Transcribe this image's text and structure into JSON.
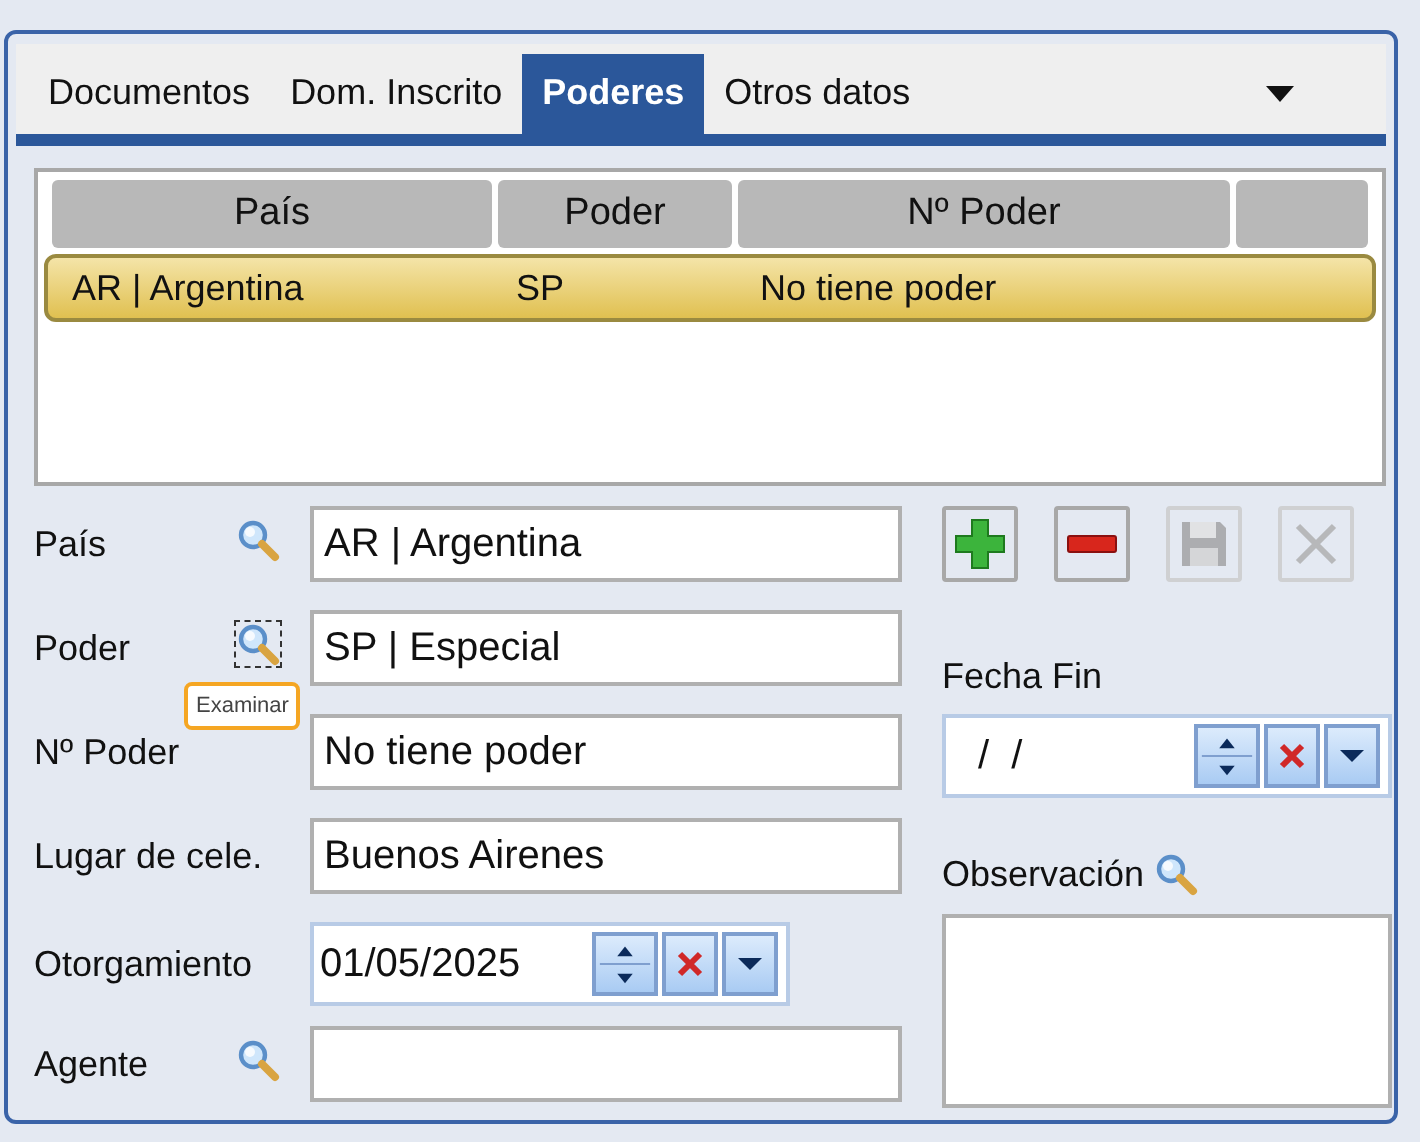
{
  "tabs": [
    {
      "label": "Documentos",
      "selected": false
    },
    {
      "label": "Dom. Inscrito",
      "selected": false
    },
    {
      "label": "Poderes",
      "selected": true
    },
    {
      "label": "Otros datos",
      "selected": false
    }
  ],
  "grid": {
    "columns": [
      "País",
      "Poder",
      "Nº Poder"
    ],
    "rows": [
      {
        "cells": [
          "AR | Argentina",
          "SP",
          "No tiene poder"
        ],
        "selected": true
      }
    ]
  },
  "fields": [
    {
      "kind": "text",
      "label": "País",
      "value": "AR | Argentina",
      "lookup": true,
      "lookup_focused": false
    },
    {
      "kind": "text",
      "label": "Poder",
      "value": "SP | Especial",
      "lookup": true,
      "lookup_focused": true,
      "tooltip": "Examinar"
    },
    {
      "kind": "text",
      "label": "Nº Poder",
      "value": "No tiene poder",
      "lookup": false
    },
    {
      "kind": "text",
      "label": "Lugar de cele.",
      "value": "Buenos Airenes",
      "lookup": false
    },
    {
      "kind": "date",
      "label": "Otorgamiento",
      "value": "01/05/2025",
      "lookup": false
    },
    {
      "kind": "text",
      "label": "Agente",
      "lookup": true,
      "lookup_focused": false
    }
  ],
  "actions": [
    {
      "kind": "add",
      "disabled": false
    },
    {
      "kind": "remove",
      "disabled": false
    },
    {
      "kind": "save",
      "disabled": true
    },
    {
      "kind": "cancel",
      "disabled": true
    }
  ],
  "fecha_fin": {
    "label": "Fecha Fin",
    "value": "/  /"
  },
  "observacion": {
    "label": "Observación"
  }
}
